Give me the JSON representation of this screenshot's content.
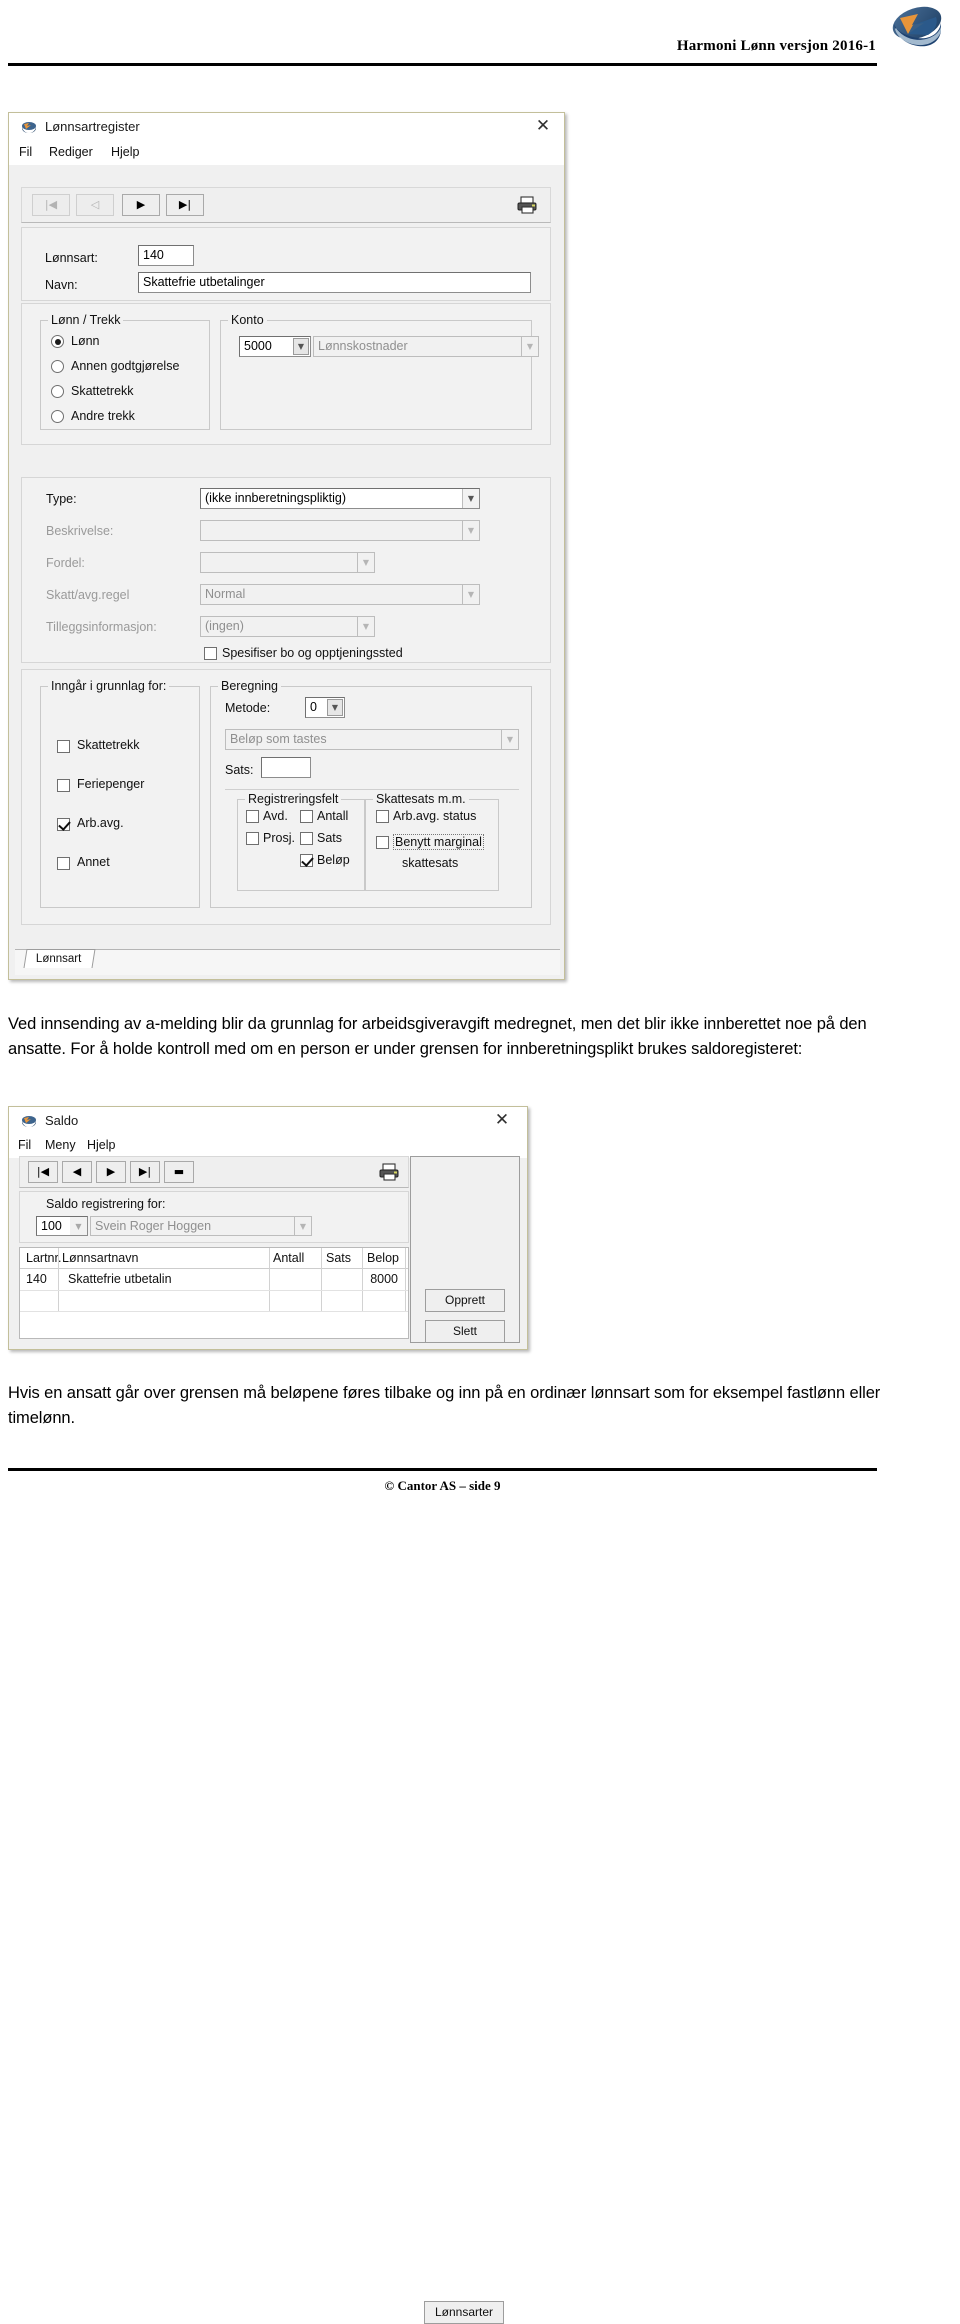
{
  "header": {
    "title": "Harmoni Lønn versjon 2016-1",
    "logo_icon": "cantor-disc-logo"
  },
  "footer": {
    "text": "© Cantor AS – side 9"
  },
  "paragraphs": {
    "p1": "Ved innsending av a-melding blir da grunnlag for arbeidsgiveravgift medregnet, men det blir ikke innberettet noe på den ansatte. For å holde kontroll med om en person er under grensen for innberetningsplikt brukes saldoregisteret:",
    "p2": "Hvis en ansatt går over grensen må beløpene føres tilbake og inn på en ordinær lønnsart som for eksempel fastlønn eller timelønn."
  },
  "lonnsart_window": {
    "title": "Lønnsartregister",
    "close_label": "✕",
    "menu": [
      "Fil",
      "Rediger",
      "Hjelp"
    ],
    "toolbar": {
      "first_label": "|◀",
      "prev_label": "◁",
      "next_label": "▶",
      "last_label": "▶|",
      "print_icon": "printer-icon"
    },
    "fields": {
      "lonnsart_label": "Lønnsart:",
      "lonnsart_value": "140",
      "navn_label": "Navn:",
      "navn_value": "Skattefrie utbetalinger"
    },
    "lonn_trekk": {
      "legend": "Lønn / Trekk",
      "options": [
        {
          "label": "Lønn",
          "selected": true
        },
        {
          "label": "Annen godtgjørelse",
          "selected": false
        },
        {
          "label": "Skattetrekk",
          "selected": false
        },
        {
          "label": "Andre trekk",
          "selected": false
        }
      ]
    },
    "konto": {
      "legend": "Konto",
      "number": "5000",
      "name": "Lønnskostnader"
    },
    "type_section": {
      "type_label": "Type:",
      "type_value": "(ikke innberetningspliktig)",
      "beskrivelse_label": "Beskrivelse:",
      "beskrivelse_value": "",
      "fordel_label": "Fordel:",
      "fordel_value": "",
      "skatt_label": "Skatt/avg.regel",
      "skatt_value": "Normal",
      "tillegg_label": "Tilleggsinformasjon:",
      "tillegg_value": "(ingen)",
      "spesifiser_label": "Spesifiser bo og opptjeningssted",
      "spesifiser_checked": false
    },
    "grunnlag": {
      "legend": "Inngår i grunnlag for:",
      "items": [
        {
          "label": "Skattetrekk",
          "checked": false
        },
        {
          "label": "Feriepenger",
          "checked": false
        },
        {
          "label": "Arb.avg.",
          "checked": true
        },
        {
          "label": "Annet",
          "checked": false
        }
      ]
    },
    "beregning": {
      "legend": "Beregning",
      "metode_label": "Metode:",
      "metode_value": "0",
      "formula_value": "Beløp som tastes",
      "sats_label": "Sats:",
      "sats_value": "",
      "registreringsfelt": {
        "legend": "Registreringsfelt",
        "items": [
          {
            "label": "Avd.",
            "checked": false
          },
          {
            "label": "Antall",
            "checked": false
          },
          {
            "label": "Prosj.",
            "checked": false
          },
          {
            "label": "Sats",
            "checked": false
          },
          {
            "label": "Beløp",
            "checked": true
          }
        ]
      },
      "skattesats": {
        "legend": "Skattesats m.m.",
        "items": [
          {
            "label": "Arb.avg. status",
            "checked": false
          },
          {
            "label": "Benytt marginal",
            "label2": "skattesats",
            "checked": false
          }
        ]
      }
    },
    "tab_label": "Lønnsart"
  },
  "saldo_window": {
    "title": "Saldo",
    "close_label": "✕",
    "menu": [
      "Fil",
      "Meny",
      "Hjelp"
    ],
    "toolbar": {
      "first_label": "|◀",
      "prev_label": "◀",
      "next_label": "▶",
      "last_label": "▶|",
      "delete_label": "▬",
      "print_icon": "printer-icon"
    },
    "registrering": {
      "label": "Saldo registrering for:",
      "number": "100",
      "name": "Svein Roger Hoggen"
    },
    "table": {
      "columns": [
        "Lartnr.",
        "Lønnsartnavn",
        "Antall",
        "Sats",
        "Belop"
      ],
      "rows": [
        {
          "lartnr": "140",
          "navn": "Skattefrie utbetalin",
          "antall": "",
          "sats": "",
          "belop": "8000"
        },
        {
          "lartnr": "",
          "navn": "",
          "antall": "",
          "sats": "",
          "belop": ""
        }
      ]
    },
    "buttons": [
      {
        "label": "Opprett"
      },
      {
        "label": "Slett"
      },
      {
        "label": "Lønnsarter"
      }
    ]
  }
}
